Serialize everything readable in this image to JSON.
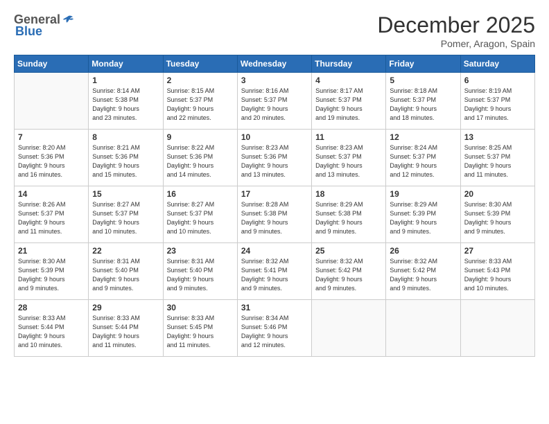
{
  "logo": {
    "general": "General",
    "blue": "Blue"
  },
  "title": {
    "month_year": "December 2025",
    "location": "Pomer, Aragon, Spain"
  },
  "weekdays": [
    "Sunday",
    "Monday",
    "Tuesday",
    "Wednesday",
    "Thursday",
    "Friday",
    "Saturday"
  ],
  "weeks": [
    [
      {
        "day": "",
        "info": ""
      },
      {
        "day": "1",
        "info": "Sunrise: 8:14 AM\nSunset: 5:38 PM\nDaylight: 9 hours\nand 23 minutes."
      },
      {
        "day": "2",
        "info": "Sunrise: 8:15 AM\nSunset: 5:37 PM\nDaylight: 9 hours\nand 22 minutes."
      },
      {
        "day": "3",
        "info": "Sunrise: 8:16 AM\nSunset: 5:37 PM\nDaylight: 9 hours\nand 20 minutes."
      },
      {
        "day": "4",
        "info": "Sunrise: 8:17 AM\nSunset: 5:37 PM\nDaylight: 9 hours\nand 19 minutes."
      },
      {
        "day": "5",
        "info": "Sunrise: 8:18 AM\nSunset: 5:37 PM\nDaylight: 9 hours\nand 18 minutes."
      },
      {
        "day": "6",
        "info": "Sunrise: 8:19 AM\nSunset: 5:37 PM\nDaylight: 9 hours\nand 17 minutes."
      }
    ],
    [
      {
        "day": "7",
        "info": "Sunrise: 8:20 AM\nSunset: 5:36 PM\nDaylight: 9 hours\nand 16 minutes."
      },
      {
        "day": "8",
        "info": "Sunrise: 8:21 AM\nSunset: 5:36 PM\nDaylight: 9 hours\nand 15 minutes."
      },
      {
        "day": "9",
        "info": "Sunrise: 8:22 AM\nSunset: 5:36 PM\nDaylight: 9 hours\nand 14 minutes."
      },
      {
        "day": "10",
        "info": "Sunrise: 8:23 AM\nSunset: 5:36 PM\nDaylight: 9 hours\nand 13 minutes."
      },
      {
        "day": "11",
        "info": "Sunrise: 8:23 AM\nSunset: 5:37 PM\nDaylight: 9 hours\nand 13 minutes."
      },
      {
        "day": "12",
        "info": "Sunrise: 8:24 AM\nSunset: 5:37 PM\nDaylight: 9 hours\nand 12 minutes."
      },
      {
        "day": "13",
        "info": "Sunrise: 8:25 AM\nSunset: 5:37 PM\nDaylight: 9 hours\nand 11 minutes."
      }
    ],
    [
      {
        "day": "14",
        "info": "Sunrise: 8:26 AM\nSunset: 5:37 PM\nDaylight: 9 hours\nand 11 minutes."
      },
      {
        "day": "15",
        "info": "Sunrise: 8:27 AM\nSunset: 5:37 PM\nDaylight: 9 hours\nand 10 minutes."
      },
      {
        "day": "16",
        "info": "Sunrise: 8:27 AM\nSunset: 5:37 PM\nDaylight: 9 hours\nand 10 minutes."
      },
      {
        "day": "17",
        "info": "Sunrise: 8:28 AM\nSunset: 5:38 PM\nDaylight: 9 hours\nand 9 minutes."
      },
      {
        "day": "18",
        "info": "Sunrise: 8:29 AM\nSunset: 5:38 PM\nDaylight: 9 hours\nand 9 minutes."
      },
      {
        "day": "19",
        "info": "Sunrise: 8:29 AM\nSunset: 5:39 PM\nDaylight: 9 hours\nand 9 minutes."
      },
      {
        "day": "20",
        "info": "Sunrise: 8:30 AM\nSunset: 5:39 PM\nDaylight: 9 hours\nand 9 minutes."
      }
    ],
    [
      {
        "day": "21",
        "info": "Sunrise: 8:30 AM\nSunset: 5:39 PM\nDaylight: 9 hours\nand 9 minutes."
      },
      {
        "day": "22",
        "info": "Sunrise: 8:31 AM\nSunset: 5:40 PM\nDaylight: 9 hours\nand 9 minutes."
      },
      {
        "day": "23",
        "info": "Sunrise: 8:31 AM\nSunset: 5:40 PM\nDaylight: 9 hours\nand 9 minutes."
      },
      {
        "day": "24",
        "info": "Sunrise: 8:32 AM\nSunset: 5:41 PM\nDaylight: 9 hours\nand 9 minutes."
      },
      {
        "day": "25",
        "info": "Sunrise: 8:32 AM\nSunset: 5:42 PM\nDaylight: 9 hours\nand 9 minutes."
      },
      {
        "day": "26",
        "info": "Sunrise: 8:32 AM\nSunset: 5:42 PM\nDaylight: 9 hours\nand 9 minutes."
      },
      {
        "day": "27",
        "info": "Sunrise: 8:33 AM\nSunset: 5:43 PM\nDaylight: 9 hours\nand 10 minutes."
      }
    ],
    [
      {
        "day": "28",
        "info": "Sunrise: 8:33 AM\nSunset: 5:44 PM\nDaylight: 9 hours\nand 10 minutes."
      },
      {
        "day": "29",
        "info": "Sunrise: 8:33 AM\nSunset: 5:44 PM\nDaylight: 9 hours\nand 11 minutes."
      },
      {
        "day": "30",
        "info": "Sunrise: 8:33 AM\nSunset: 5:45 PM\nDaylight: 9 hours\nand 11 minutes."
      },
      {
        "day": "31",
        "info": "Sunrise: 8:34 AM\nSunset: 5:46 PM\nDaylight: 9 hours\nand 12 minutes."
      },
      {
        "day": "",
        "info": ""
      },
      {
        "day": "",
        "info": ""
      },
      {
        "day": "",
        "info": ""
      }
    ]
  ]
}
